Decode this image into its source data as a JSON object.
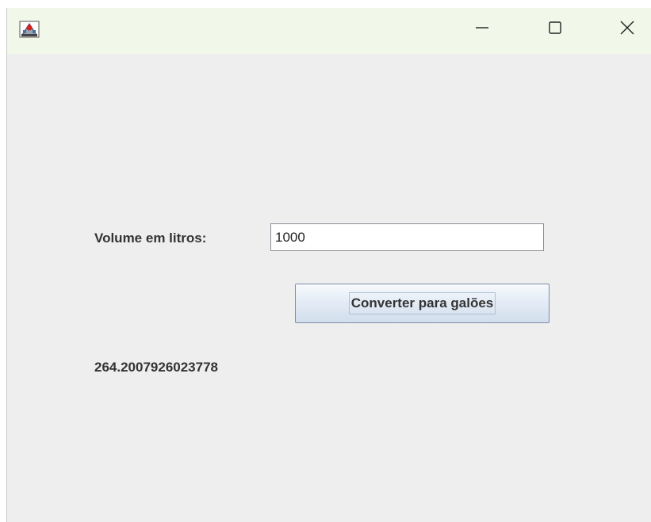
{
  "window": {
    "app_icon": "java-app-icon",
    "controls": {
      "minimize_icon": "minimize-icon",
      "maximize_icon": "maximize-icon",
      "close_icon": "close-icon"
    },
    "titlebar_color": "#f1f8ea",
    "background_color": "#eeeeee"
  },
  "form": {
    "volume_label": "Volume em litros:",
    "volume_value": "1000",
    "convert_button_label": "Converter para galões",
    "result_text": "264.2007926023778"
  }
}
